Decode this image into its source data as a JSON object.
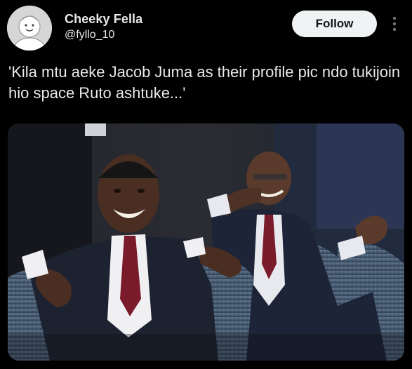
{
  "post": {
    "user": {
      "name": "Cheeky Fella",
      "handle": "@fyllo_10"
    },
    "follow_label": "Follow",
    "more_icon": "more-vertical-icon",
    "text": "'Kila mtu aeke Jacob Juma as their profile pic ndo tukijoin hio space Ruto ashtuke...'",
    "media": {
      "type": "photo"
    }
  },
  "colors": {
    "background": "#000000",
    "text": "#e7e9ea",
    "follow_bg": "#eff3f4",
    "follow_text": "#0f1419"
  }
}
